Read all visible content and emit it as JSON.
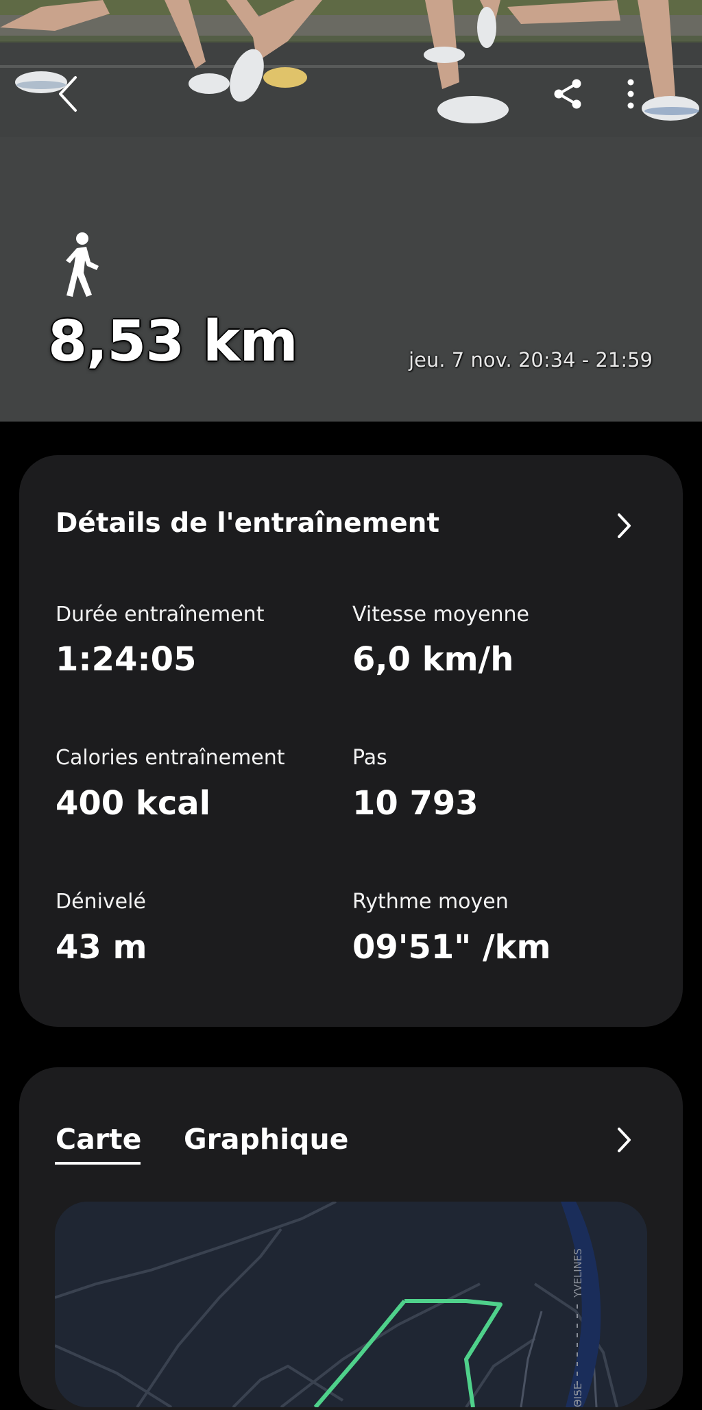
{
  "header": {
    "distance": "8,53 km",
    "date_range": "jeu. 7 nov. 20:34 - 21:59",
    "back_icon": "chevron-left-icon",
    "share_icon": "share-icon",
    "more_icon": "more-vertical-icon",
    "activity_icon": "walking-person-icon"
  },
  "details": {
    "title": "Détails de l'entraînement",
    "stats": [
      {
        "label": "Durée entraînement",
        "value": "1:24:05"
      },
      {
        "label": "Vitesse moyenne",
        "value": "6,0 km/h"
      },
      {
        "label": "Calories entraînement",
        "value": "400 kcal"
      },
      {
        "label": "Pas",
        "value": "10 793"
      },
      {
        "label": "Dénivelé",
        "value": "43 m"
      },
      {
        "label": "Rythme moyen",
        "value": "09'51\" /km"
      }
    ]
  },
  "map_card": {
    "tabs": [
      {
        "label": "Carte",
        "selected": true
      },
      {
        "label": "Graphique",
        "selected": false
      }
    ],
    "map_labels": {
      "region_1": "YVELINES",
      "region_2": "OISE"
    }
  },
  "colors": {
    "background": "#000000",
    "card": "#1c1c1e",
    "route": "#4fd18b",
    "map_bg": "#1f2633",
    "river": "#1a2d5a"
  }
}
